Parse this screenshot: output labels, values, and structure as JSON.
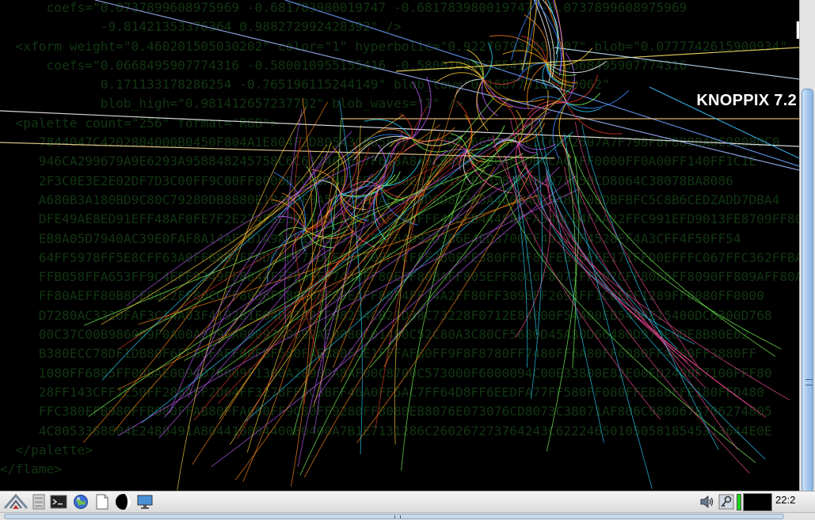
{
  "wallpaper": {
    "label": "KNOPPIX 7.2",
    "xml_lines": [
      "      coefs=\"0.0737899608975969 -0.681783980019747 -0.681783980019747 -0.0737899608975969",
      "             -9.81421353376364 0.988272992428392\" />",
      "  <xform weight=\"0.460201505030202\" color=\"1\" hyperbolic=\"0.922707931587007\" blob=\"0.0777742615900934\"",
      "      coefs=\"0.0668495907774316 -0.580010955155416 -0.580010955155416 -0.0668495907774316",
      "             0.171133178286254 -0.765196115244149\" blob_low=\"0.168779165860062\"",
      "             blob_high=\"0.981412657237702\" blob_waves=\"1\" />",
      "  <palette count=\"256\" format=\"RGB\">",
      "     7844047C4202804000B0450F804A1E804F2D80543C80583F7C5F4D73665A6F6C5C6B72607A7F798F8F8890A0C98080C0",
      "     946CA299679A9E6293A958848245758C6C61746A6E7F6C8A8A9C9F99A3B0ABBDB4CAC7FF0000FF0A00FF140FF1C1E",
      "     2F3C0E3E2E02DF7D3C00FF9C00FF8000B7C99A0E25B0D8A0C91901FCBC3582603CD78050CD8064C38078BA8086",
      "     A680B3A180BD9C80C79280DB8880E18480F0A5A7A6B9AFC0C5D6D8D3A3A4C0EAD1B4B6C0BDBFBFC5C8B6CEDZADD7DBA4",
      "     DFE49AE8ED91EFF48AF0FE7F2E274F5D3FE47EFD1F4E4F2F6FFF48EFB444F8BFA54AC34FAA22FFC991EFD9013FE8709FF8090",
      "     EB8A05D7940AC39E0FAF8A14AF7B1A9A6F1F82392A7F2F64D92D3B6E4ED3700FF4012FF4528FF4A3CFF4F50FF54",
      "     64FF5978FF5E8CFF63A0FF68B4FF6DC8FF72DCFF77F0FF7CFFF780FFE380FFCF80FEB76FFE171FFD0EFFFC067FFC362FFBA5D",
      "     FFB058FFA653FF9C4EFF9249FF8844FF7E3FFF7440FF80EFF80BAFF805EFF80C6F8072FF807CFF8086FF8090FF809AFF80A4",
      "     FF80AEFF80B8FF80C2FF80CCFF80D6FF80E0FF80EAFF80F4FF44A2FF80FF3098FF2693FF1C8EFF1289FF0080FF0000",
      "     D7280AC3320FAF3C14A03F4192B1E04DA1207C98234CB21D38C73228F0712E84000F54A00EB5400E15400DC6300D768",
      "     00C37C00B986009F0A00A009CA00097A0092AE0080C01480C52C80A3C80CF5680D45A80D66480D970E0DE8B80E62",
      "     B380ECC78DF1DB80F6EF80FAFF80FBF580FAEB80FCE1FFFAF80FF9F8F8780FF7480FF6A80FF6080FF4C80FF3880FF",
      "     1080FF6885FF008AE0094D78009F1300A28900A8AF00C8700C573000F6000094C00E33800E82E00ED2400F7100FFF80",
      "     28FF143CFF1E50FF285AFF2D64FF3278FF3C8BFF46A0FF5AC7FF64D8FF6EEDFA77FF580FF080FFEB80FFE180FFD480",
      "     FFC380FFB980FFB080FFAB80FFA680FF9C80FF9280FF8080EB8076E073076CD8073C38071AF806C9880678706274805",
      "     4C8053388804E2480491A80441080440080400A7B1E7131286C260267273764243C6222465010505818545313644E0E",
      "  </palette>",
      "</flame>"
    ]
  },
  "taskbar": {
    "icons": [
      {
        "name": "knoppix-menu-icon"
      },
      {
        "name": "file-manager-icon"
      },
      {
        "name": "terminal-icon"
      },
      {
        "name": "web-browser-icon"
      },
      {
        "name": "text-editor-icon"
      },
      {
        "name": "display-settings-icon"
      },
      {
        "name": "monitor-icon"
      }
    ],
    "tray": {
      "volume_icon": "speaker-icon",
      "network_icon": "network-key-icon",
      "clock": "22:2"
    }
  }
}
